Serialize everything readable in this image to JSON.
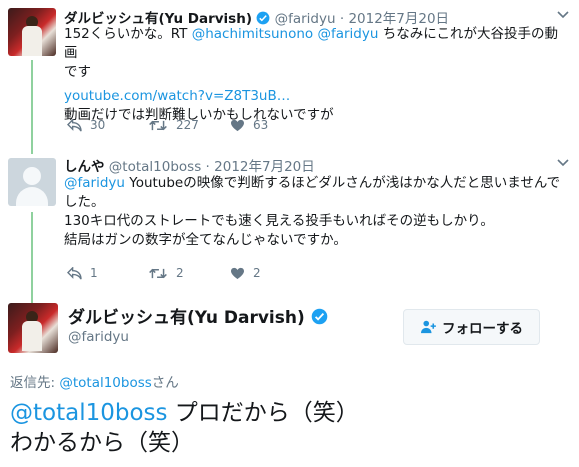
{
  "tweets": [
    {
      "name": "ダルビッシュ有(Yu Darvish)",
      "handle": "@faridyu",
      "dot": "·",
      "date": "2012年7月20日",
      "text_line1": "152くらいかな。RT ",
      "mention1": "@hachimitsunono",
      "mention2": "@faridyu",
      "text_line1b": " ちなみにこれが大谷投手の動画",
      "text_line2": "です",
      "link": "youtube.com/watch?v=Z8T3uB…",
      "text_line3": "動画だけでは判断難しいかもしれないですが",
      "replies": "30",
      "retweets": "227",
      "likes": "63"
    },
    {
      "name": "しんや",
      "handle": "@total10boss",
      "dot": "·",
      "date": "2012年7月20日",
      "mention": "@faridyu",
      "text_line1": " Youtubeの映像で判断するほどダルさんが浅はかな人だと思いませんで",
      "text_line2": "した。",
      "text_line3": "130キロ代のストレートでも速く見える投手もいればその逆もしかり。",
      "text_line4": "結局はガンの数字が全てなんじゃないですか。",
      "replies": "1",
      "retweets": "2",
      "likes": "2"
    }
  ],
  "main": {
    "name": "ダルビッシュ有(Yu Darvish)",
    "handle": "@faridyu",
    "follow_label": "フォローする",
    "reply_prefix": "返信先: ",
    "reply_handle": "@total10boss",
    "reply_suffix": "さん",
    "mention": "@total10boss",
    "text_line1": " プロだから（笑）",
    "text_line2": "わかるから（笑）"
  },
  "colors": {
    "link": "#1b95e0",
    "thread": "#8fd19e",
    "muted": "#657786",
    "verified": "#1da1f2"
  },
  "icons": [
    "verified-badge-icon",
    "caret-down-icon",
    "reply-icon",
    "retweet-icon",
    "heart-icon",
    "follow-person-icon"
  ]
}
